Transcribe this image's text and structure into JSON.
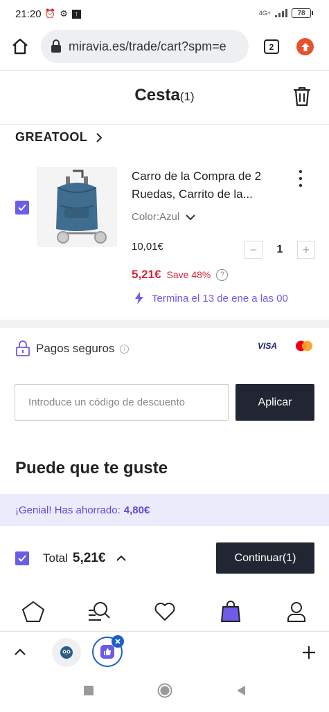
{
  "status_bar": {
    "time": "21:20",
    "network": "4G+",
    "battery": "78"
  },
  "browser": {
    "url": "miravia.es/trade/cart?spm=e",
    "tab_count": "2"
  },
  "header": {
    "title": "Cesta",
    "count": "(1)"
  },
  "shop": {
    "name": "GREATOOL"
  },
  "product": {
    "title": "Carro de la Compra de 2 Ruedas, Carrito de la...",
    "color_label": "Color:Azul",
    "original_price": "10,01€",
    "quantity": "1",
    "sale_price": "5,21€",
    "save_text": "Save 48%",
    "promo_end": "Termina el 13 de ene a las 00"
  },
  "payments": {
    "label": "Pagos seguros",
    "visa": "VISA"
  },
  "coupon": {
    "placeholder": "Introduce un código de descuento",
    "apply_label": "Aplicar"
  },
  "recommendations": {
    "title": "Puede que te guste"
  },
  "savings": {
    "label": "¡Genial! Has ahorrado:",
    "amount": "4,80€"
  },
  "checkout": {
    "total_label": "Total",
    "total_value": "5,21€",
    "continue_label": "Continuar(1)"
  },
  "colors": {
    "accent": "#6c5ce7",
    "sale_red": "#d0283a",
    "dark_button": "#222633"
  }
}
